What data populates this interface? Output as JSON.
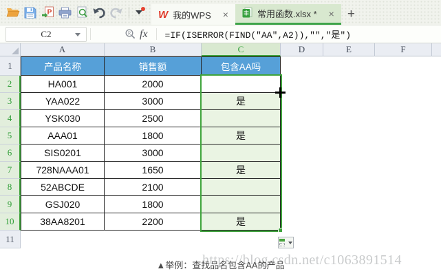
{
  "titlebar": {
    "quick_access_icons": [
      "open-folder",
      "save",
      "export-pdf",
      "print",
      "print-preview",
      "undo",
      "redo",
      "customize-toolbar"
    ],
    "tabs": [
      {
        "label": "我的WPS",
        "close_glyph": "×"
      },
      {
        "label": "常用函数.xlsx *",
        "close_glyph": "×",
        "active": true
      }
    ],
    "new_tab_glyph": "+"
  },
  "formula_bar": {
    "cell_reference": "C2",
    "fx_label": "fx",
    "formula": "=IF(ISERROR(FIND(″AA″,A2)),″″,″是″)"
  },
  "sheet": {
    "visible_columns": [
      "A",
      "B",
      "C",
      "D",
      "E",
      "F"
    ],
    "active_column": "C",
    "visible_rows": [
      "1",
      "2",
      "3",
      "4",
      "5",
      "6",
      "7",
      "8",
      "9",
      "10",
      "11"
    ],
    "selected_rows": [
      "2",
      "3",
      "4",
      "5",
      "6",
      "7",
      "8",
      "9",
      "10"
    ],
    "selection": {
      "range": "C2:C10",
      "active_cell": "C2"
    },
    "header_row": [
      "产品名称",
      "销售额",
      "包含AA吗"
    ],
    "data_rows": [
      [
        "HA001",
        "2000",
        ""
      ],
      [
        "YAA022",
        "3000",
        "是"
      ],
      [
        "YSK030",
        "2500",
        ""
      ],
      [
        "AAA01",
        "1800",
        "是"
      ],
      [
        "SIS0201",
        "3000",
        ""
      ],
      [
        "728NAAA01",
        "1650",
        "是"
      ],
      [
        "52ABCDE",
        "2100",
        ""
      ],
      [
        "GSJ020",
        "1800",
        ""
      ],
      [
        "38AA8201",
        "2200",
        "是"
      ]
    ]
  },
  "caption": "▲举例：查找品名包含AA的产品",
  "watermark": "https://blog.csdn.net/c1063891514",
  "colors": {
    "table_header_fill": "#56a0d8",
    "selection_green": "#3fa43c",
    "selected_cell_fill": "#eaf4e3",
    "active_tab_bg": "#d8e8cf",
    "grid_header_bg": "#eaedf3",
    "wps_logo_red": "#e03a2a"
  }
}
